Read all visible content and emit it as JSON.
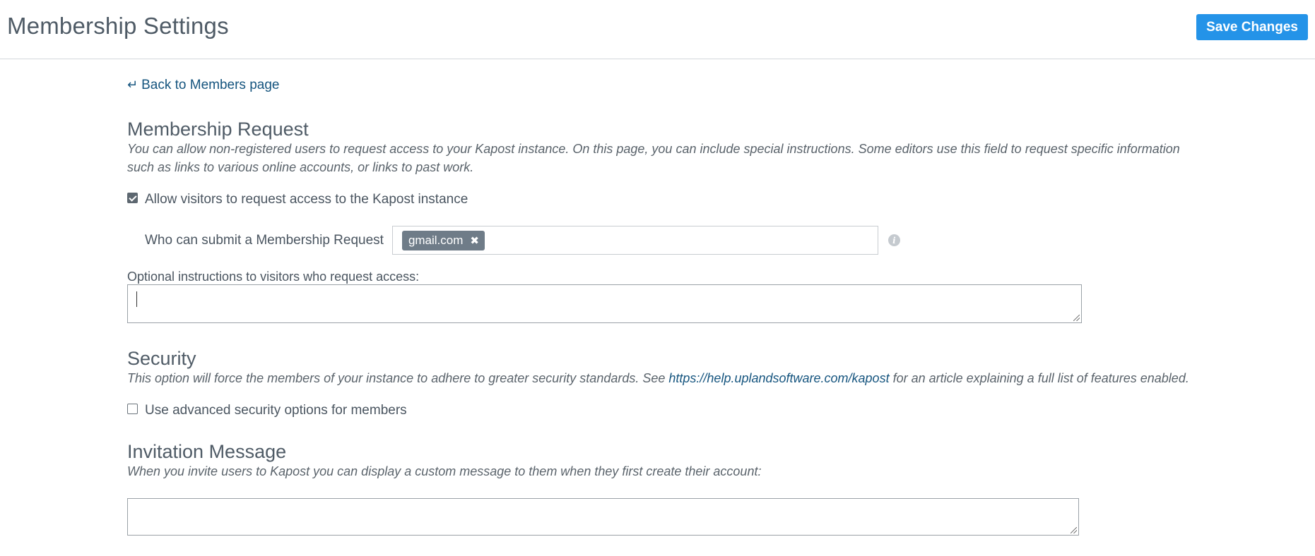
{
  "header": {
    "title": "Membership Settings",
    "save_label": "Save Changes"
  },
  "back_link": {
    "arrow": "↵",
    "label": "Back to Members page"
  },
  "membership_request": {
    "title": "Membership Request",
    "description": "You can allow non-registered users to request access to your Kapost instance. On this page, you can include special instructions. Some editors use this field to request specific information such as links to various online accounts, or links to past work.",
    "allow_checkbox_label": "Allow visitors to request access to the Kapost instance",
    "allow_checked": true,
    "who_label": "Who can submit a Membership Request",
    "domain_tags": [
      "gmail.com"
    ],
    "tag_remove_glyph": "✖",
    "info_glyph": "i",
    "instructions_label": "Optional instructions to visitors who request access:",
    "instructions_value": ""
  },
  "security": {
    "title": "Security",
    "description_before": "This option will force the members of your instance to adhere to greater security standards. See ",
    "link_text": "https://help.uplandsoftware.com/kapost",
    "description_after": " for an article explaining a full list of features enabled.",
    "advanced_checkbox_label": "Use advanced security options for members",
    "advanced_checked": false
  },
  "invitation": {
    "title": "Invitation Message",
    "description": "When you invite users to Kapost you can display a custom message to them when they first create their account:",
    "message_value": ""
  },
  "colors": {
    "accent": "#2493e8",
    "link": "#16557f",
    "tag_bg": "#6f7c88"
  }
}
